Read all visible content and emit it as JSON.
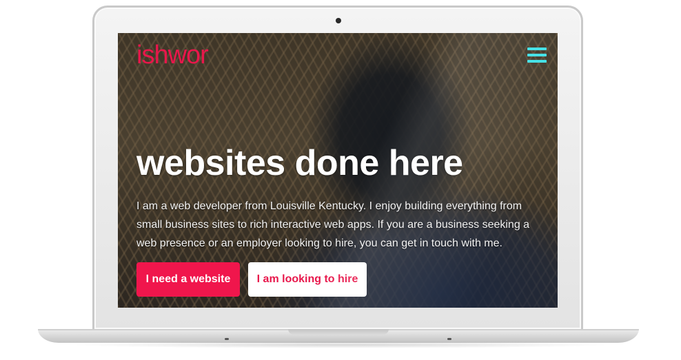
{
  "brand": {
    "logo_text": "ishwor",
    "accent_color": "#e8174b",
    "menu_icon_color": "#3ee0e6"
  },
  "nav": {
    "menu_icon": "hamburger-menu-icon"
  },
  "hero": {
    "title": "websites done here",
    "description": "I am a web developer from Louisville Kentucky. I enjoy building everything from small business sites to rich interactive web apps. If you are a business seeking a web presence or an employer looking to hire, you can get in touch with me.",
    "primary_button": "I need a website",
    "secondary_button": "I am looking to hire"
  }
}
